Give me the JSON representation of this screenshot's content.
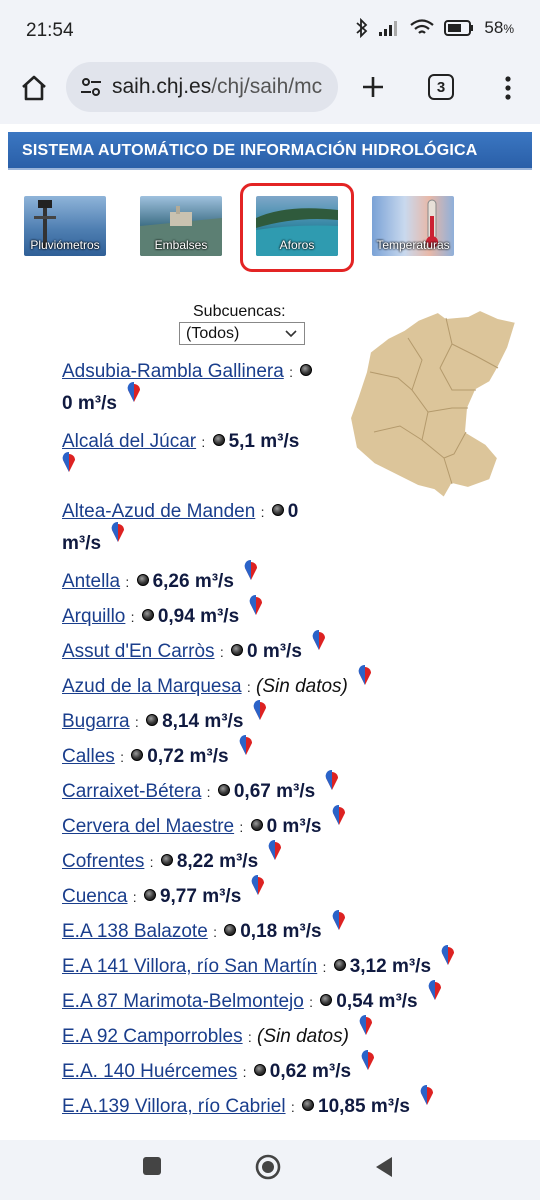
{
  "status": {
    "time": "21:54",
    "battery": "58",
    "battery_unit": "%"
  },
  "browser": {
    "url_host": "saih.chj.es",
    "url_path": "/chj/saih/mc",
    "tab_count": "3"
  },
  "header": {
    "title": "SISTEMA AUTOMÁTICO DE INFORMACIÓN HIDROLÓGICA"
  },
  "nav": [
    {
      "label": "Pluviómetros"
    },
    {
      "label": "Embalses"
    },
    {
      "label": "Aforos",
      "selected": true
    },
    {
      "label": "Temperaturas"
    }
  ],
  "subcuencas": {
    "label": "Subcuencas:",
    "selected": "(Todos)"
  },
  "sep": ":",
  "gauges": [
    {
      "name": "Adsubia-Rambla Gallinera",
      "value": "0 m³/s"
    },
    {
      "name": "Alcalá del Júcar",
      "value": "5,1 m³/s"
    },
    {
      "name": "Altea-Azud de Manden",
      "value": "0 m³/s"
    },
    {
      "name": "Antella",
      "value": "6,26 m³/s"
    },
    {
      "name": "Arquillo",
      "value": "0,94 m³/s"
    },
    {
      "name": "Assut d'En Carròs",
      "value": "0 m³/s"
    },
    {
      "name": "Azud de la Marquesa",
      "value": "(Sin datos)"
    },
    {
      "name": "Bugarra",
      "value": "8,14 m³/s"
    },
    {
      "name": "Calles",
      "value": "0,72 m³/s"
    },
    {
      "name": "Carraixet-Bétera",
      "value": "0,67 m³/s"
    },
    {
      "name": "Cervera del Maestre",
      "value": "0 m³/s"
    },
    {
      "name": "Cofrentes",
      "value": "8,22 m³/s"
    },
    {
      "name": "Cuenca",
      "value": "9,77 m³/s"
    },
    {
      "name": "E.A 138 Balazote",
      "value": "0,18 m³/s"
    },
    {
      "name": "E.A 141 Villora, río San Martín",
      "value": "3,12 m³/s"
    },
    {
      "name": "E.A 87 Marimota-Belmontejo",
      "value": "0,54 m³/s"
    },
    {
      "name": "E.A 92 Camporrobles",
      "value": "(Sin datos)"
    },
    {
      "name": "E.A. 140 Huércemes",
      "value": "0,62 m³/s"
    },
    {
      "name": "E.A.139 Villora, río Cabriel",
      "value": "10,85 m³/s"
    }
  ],
  "split_values": {
    "adsubia_value": "0 m³/s",
    "altea_part1": "0",
    "altea_part2": "m³/s"
  },
  "colors": {
    "header_blue": "#2f66ae",
    "link": "#1a3e8c",
    "selected_frame": "#e32424",
    "map_fill": "#dcc59a"
  }
}
